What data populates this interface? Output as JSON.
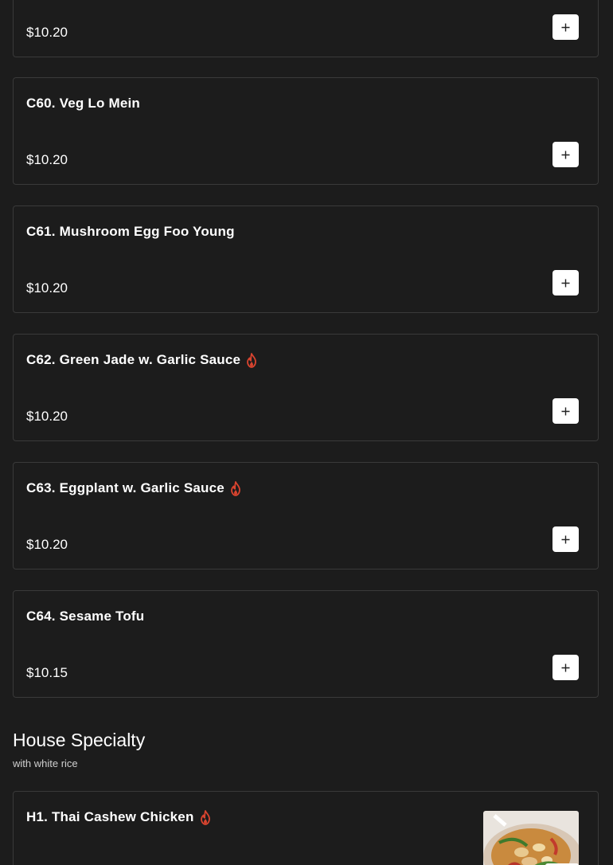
{
  "colors": {
    "background": "#1c1c1c",
    "card_border": "#3a3a3a",
    "spicy": "#d9442f",
    "button_bg": "#ffffff"
  },
  "icons": {
    "add": "plus-icon",
    "spicy": "flame-icon"
  },
  "items_top": [
    {
      "price": "$10.20"
    }
  ],
  "items": [
    {
      "name": "C60. Veg Lo Mein",
      "price": "$10.20",
      "spicy": false
    },
    {
      "name": "C61. Mushroom Egg Foo Young",
      "price": "$10.20",
      "spicy": false
    },
    {
      "name": "C62. Green Jade w. Garlic Sauce",
      "price": "$10.20",
      "spicy": true
    },
    {
      "name": "C63. Eggplant w. Garlic Sauce",
      "price": "$10.20",
      "spicy": true
    },
    {
      "name": "C64. Sesame Tofu",
      "price": "$10.15",
      "spicy": false
    }
  ],
  "section": {
    "title": "House Specialty",
    "subtitle": "with white rice"
  },
  "specialty_items": [
    {
      "name": "H1. Thai Cashew Chicken",
      "spicy": true,
      "has_image": true
    }
  ]
}
